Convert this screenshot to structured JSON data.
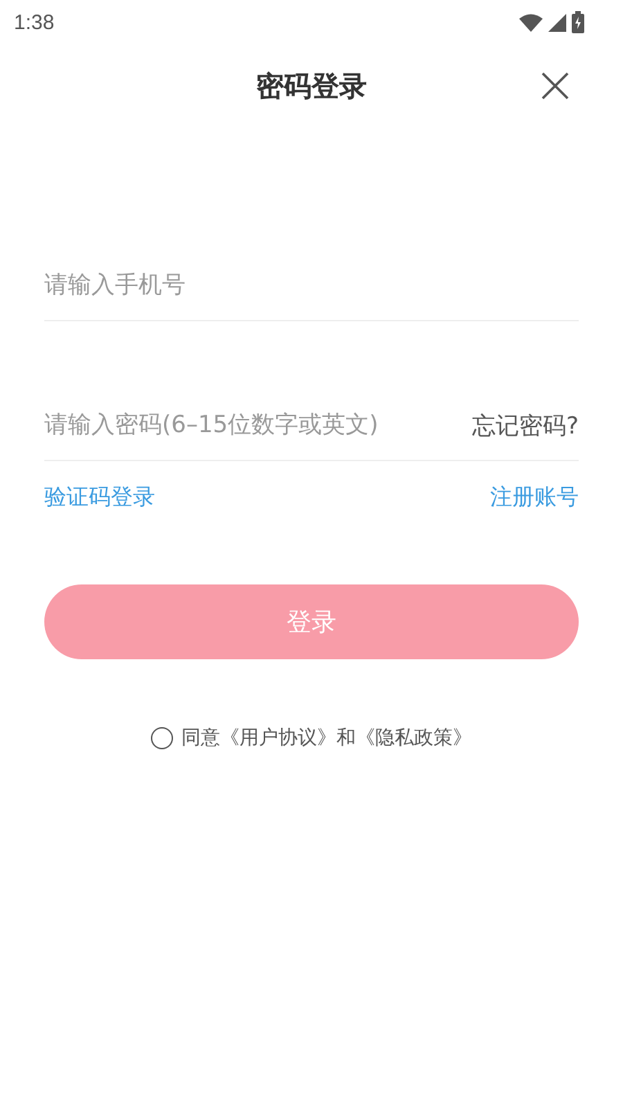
{
  "status_bar": {
    "time": "1:38"
  },
  "header": {
    "title": "密码登录"
  },
  "phone_field": {
    "placeholder": "请输入手机号"
  },
  "password_field": {
    "placeholder": "请输入密码(6–15位数字或英文)",
    "forgot_link": "忘记密码?"
  },
  "links": {
    "left": "验证码登录",
    "right": "注册账号"
  },
  "login_button": {
    "label": "登录",
    "disabled": true
  },
  "agreement": {
    "checked": false,
    "text": "同意《用户协议》和《隐私政策》"
  }
}
